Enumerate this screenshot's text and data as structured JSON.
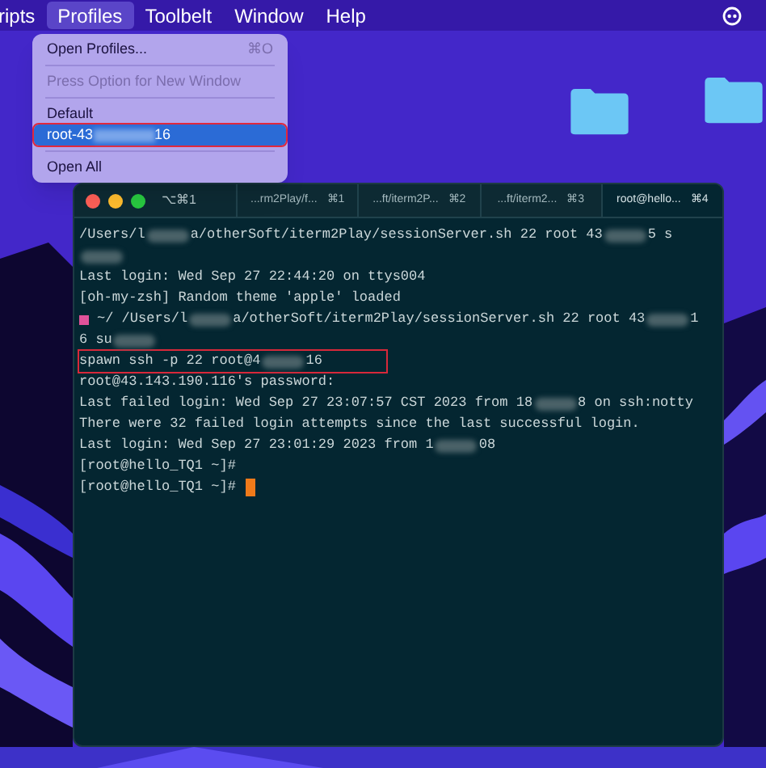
{
  "menu_bar": {
    "items": [
      {
        "label": "ripts",
        "selected": false
      },
      {
        "label": "Profiles",
        "selected": true
      },
      {
        "label": "Toolbelt",
        "selected": false
      },
      {
        "label": "Window",
        "selected": false
      },
      {
        "label": "Help",
        "selected": false
      }
    ]
  },
  "profiles_menu": {
    "items": [
      {
        "kind": "item",
        "label": "Open Profiles...",
        "shortcut": "⌘O",
        "disabled": false,
        "selected": false
      },
      {
        "kind": "separator"
      },
      {
        "kind": "item",
        "label": "Press Option for New Window",
        "disabled": true,
        "selected": false
      },
      {
        "kind": "separator"
      },
      {
        "kind": "item",
        "label": "Default",
        "disabled": false,
        "selected": false
      },
      {
        "kind": "item",
        "label": "root-43",
        "label_end": "16",
        "redacted": true,
        "disabled": false,
        "selected": true,
        "highlighted": true
      },
      {
        "kind": "separator"
      },
      {
        "kind": "item",
        "label": "Open All",
        "disabled": false,
        "selected": false
      }
    ]
  },
  "terminal": {
    "title": "⌥⌘1",
    "tabs": [
      {
        "label": "...rm2Play/f...",
        "shortcut": "⌘1",
        "selected": false
      },
      {
        "label": "...ft/iterm2P...",
        "shortcut": "⌘2",
        "selected": false
      },
      {
        "label": "...ft/iterm2...",
        "shortcut": "⌘3",
        "selected": false
      },
      {
        "label": "root@hello...",
        "shortcut": "⌘4",
        "selected": true
      }
    ],
    "lines": [
      {
        "highlighted": false,
        "segments": [
          {
            "kind": "text",
            "text": "/Users/l"
          },
          {
            "kind": "redacted"
          },
          {
            "kind": "text",
            "text": "a/otherSoft/iterm2Play/sessionServer.sh 22 root 43"
          },
          {
            "kind": "redacted"
          },
          {
            "kind": "text",
            "text": "5 s"
          }
        ]
      },
      {
        "highlighted": false,
        "segments": [
          {
            "kind": "redacted"
          }
        ]
      },
      {
        "highlighted": false,
        "segments": [
          {
            "kind": "text",
            "text": "Last login: Wed Sep 27 22:44:20 on ttys004"
          }
        ]
      },
      {
        "highlighted": false,
        "segments": [
          {
            "kind": "text",
            "text": "[oh-my-zsh] Random theme 'apple' loaded"
          }
        ]
      },
      {
        "highlighted": false,
        "segments": [
          {
            "kind": "mark"
          },
          {
            "kind": "text",
            "text": "~/ /Users/l"
          },
          {
            "kind": "redacted"
          },
          {
            "kind": "text",
            "text": "a/otherSoft/iterm2Play/sessionServer.sh 22 root 43"
          },
          {
            "kind": "redacted"
          },
          {
            "kind": "text",
            "text": "1"
          }
        ]
      },
      {
        "highlighted": false,
        "segments": [
          {
            "kind": "text",
            "text": "6 su"
          },
          {
            "kind": "redacted"
          }
        ]
      },
      {
        "highlighted": true,
        "segments": [
          {
            "kind": "text",
            "text": "spawn ssh -p 22 root@4"
          },
          {
            "kind": "redacted"
          },
          {
            "kind": "text",
            "text": "16"
          }
        ]
      },
      {
        "highlighted": false,
        "segments": [
          {
            "kind": "text",
            "text": "root@43.143.190.116's password:"
          }
        ]
      },
      {
        "highlighted": false,
        "segments": [
          {
            "kind": "text",
            "text": "Last failed login: Wed Sep 27 23:07:57 CST 2023 from 18"
          },
          {
            "kind": "redacted"
          },
          {
            "kind": "text",
            "text": "8 on ssh:notty"
          }
        ]
      },
      {
        "highlighted": false,
        "segments": [
          {
            "kind": "text",
            "text": "There were 32 failed login attempts since the last successful login."
          }
        ]
      },
      {
        "highlighted": false,
        "segments": [
          {
            "kind": "text",
            "text": "Last login: Wed Sep 27 23:01:29 2023 from 1"
          },
          {
            "kind": "redacted"
          },
          {
            "kind": "text",
            "text": "08"
          }
        ]
      },
      {
        "highlighted": false,
        "segments": [
          {
            "kind": "text",
            "text": "[root@hello_TQ1 ~]#"
          }
        ]
      },
      {
        "highlighted": false,
        "segments": [
          {
            "kind": "text",
            "text": "[root@hello_TQ1 ~]#"
          },
          {
            "kind": "cursor"
          }
        ]
      }
    ]
  }
}
